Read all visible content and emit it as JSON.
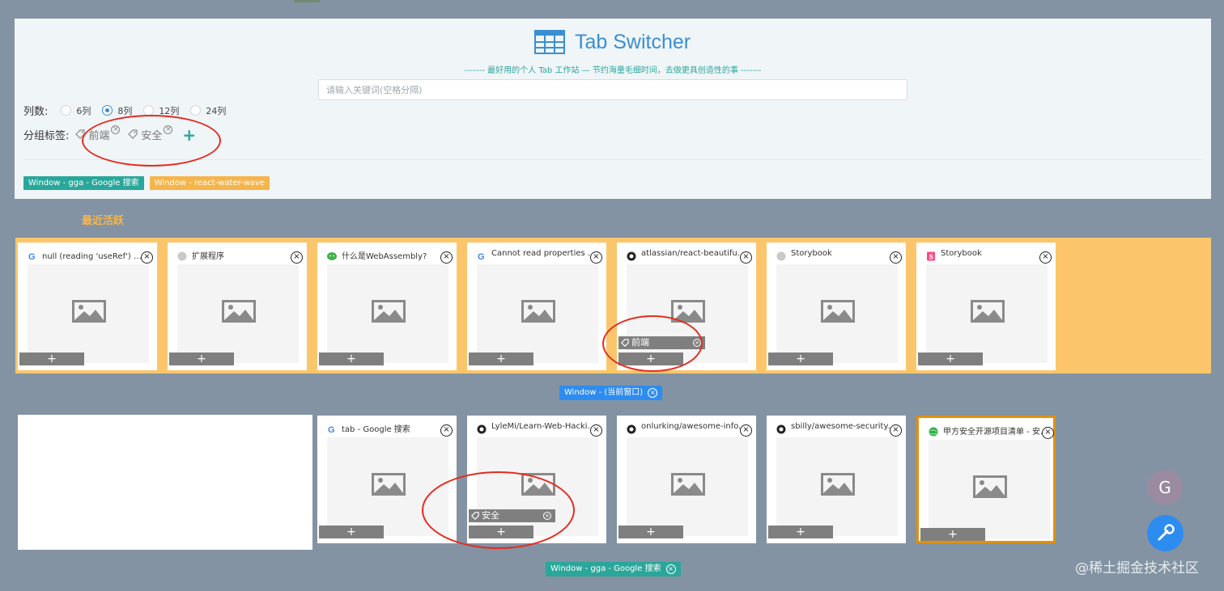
{
  "header": {
    "title": "Tab Switcher",
    "slogan": "------- 最好用的个人 Tab 工作站 — 节约海量毛细时间，去做更具创造性的事 -------",
    "search_placeholder": "请输入关键词(空格分隔)"
  },
  "columns": {
    "label": "列数:",
    "options": [
      "6列",
      "8列",
      "12列",
      "24列"
    ],
    "selected": "8列"
  },
  "groups": {
    "label": "分组标签:",
    "tags": [
      "前端",
      "安全"
    ]
  },
  "window_chips": [
    {
      "label": "Window - gga - Google 搜索",
      "color": "#2aa79b"
    },
    {
      "label": "Window - react-water-wave",
      "color": "#f5b54c"
    }
  ],
  "recent": {
    "label": "最近活跃",
    "tabs": [
      {
        "title": "null (reading 'useRef') 是...",
        "icon": "google-icon"
      },
      {
        "title": "扩展程序",
        "icon": "gray-dot-icon"
      },
      {
        "title": "什么是WebAssembly?",
        "icon": "wechat-icon"
      },
      {
        "title": "Cannot read properties o...",
        "icon": "google-icon"
      },
      {
        "title": "atlassian/react-beautiful...",
        "icon": "github-icon",
        "tag": "前端"
      },
      {
        "title": "Storybook",
        "icon": "gray-dot-icon"
      },
      {
        "title": "Storybook",
        "icon": "storybook-icon"
      }
    ]
  },
  "current_window": {
    "label": "Window - (当前窗口)",
    "color": "#2d8cf0",
    "tabs": [
      {
        "title": "tab - Google 搜索",
        "icon": "google-icon"
      },
      {
        "title": "LyleMi/Learn-Web-Hacki...",
        "icon": "github-icon",
        "tag": "安全"
      },
      {
        "title": "onlurking/awesome-info...",
        "icon": "github-icon"
      },
      {
        "title": "sbilly/awesome-security:...",
        "icon": "github-icon"
      },
      {
        "title": "甲方安全开源项目清单 - 安...",
        "icon": "globe-icon"
      }
    ]
  },
  "bottom_window": {
    "label": "Window - gga - Google 搜索",
    "color": "#2aa79b"
  },
  "ui": {
    "add_symbol": "+",
    "close_symbol": "×",
    "avatar_letter": "G",
    "watermark": "@稀土掘金技术社区"
  },
  "colors": {
    "accent": "#3a8fd0",
    "teal": "#2aa79b",
    "orange": "#fbc66b",
    "background": "#8393a3"
  }
}
